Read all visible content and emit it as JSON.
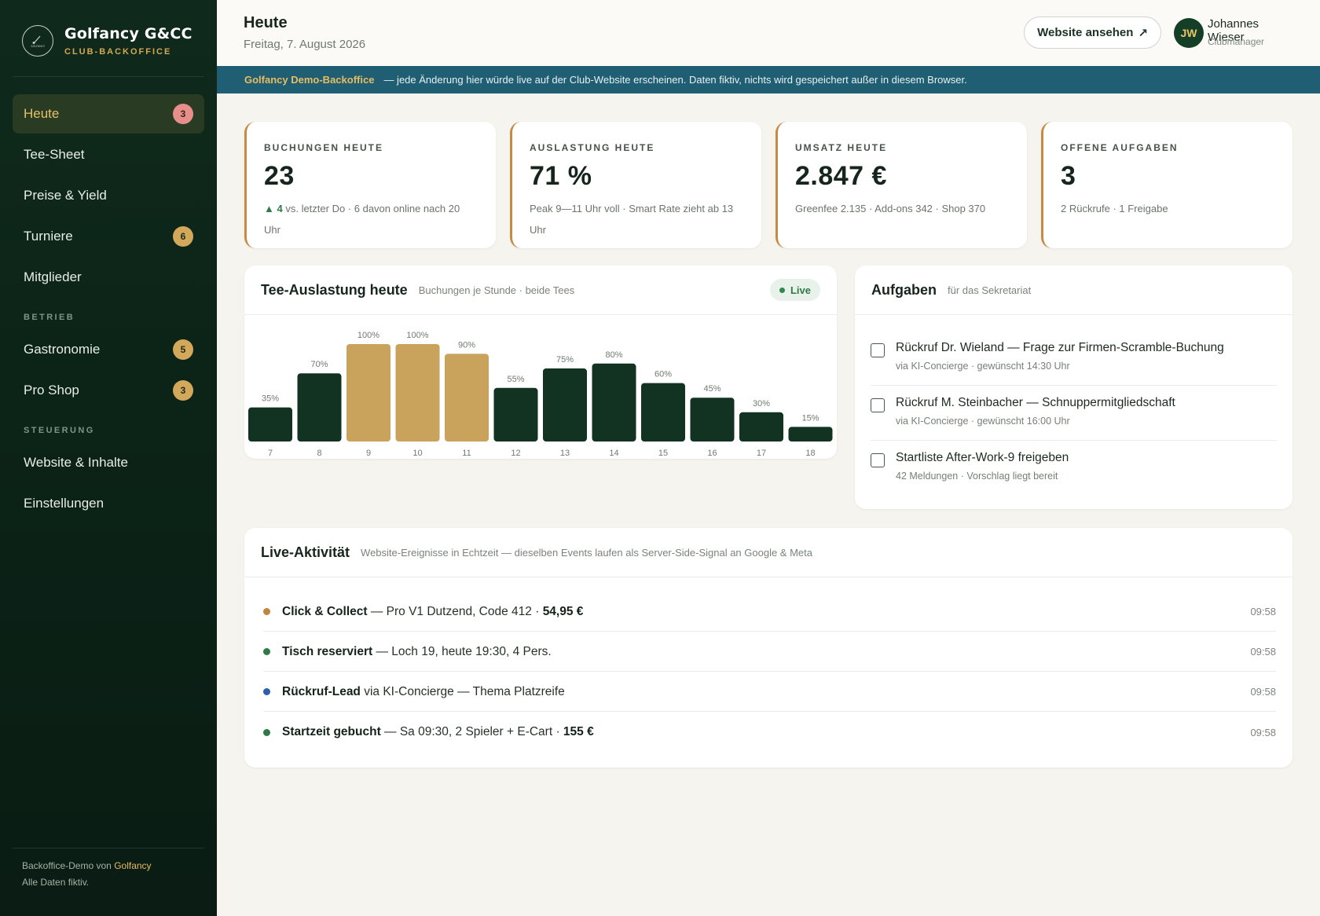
{
  "sidebar": {
    "brand_name": "Golfancy G&CC",
    "brand_sub": "CLUB-BACKOFFICE",
    "logo_text": "GOLFANCY",
    "items": [
      {
        "label": "Heute",
        "badge": "3"
      },
      {
        "label": "Tee-Sheet"
      },
      {
        "label": "Preise & Yield"
      },
      {
        "label": "Turniere",
        "badge": "6"
      },
      {
        "label": "Mitglieder"
      }
    ],
    "section_betrieb": "BETRIEB",
    "betrieb_items": [
      {
        "label": "Gastronomie",
        "badge": "5"
      },
      {
        "label": "Pro Shop",
        "badge": "3"
      }
    ],
    "section_steuerung": "STEUERUNG",
    "steuerung_items": [
      {
        "label": "Website & Inhalte"
      },
      {
        "label": "Einstellungen"
      }
    ],
    "footer_prefix": "Backoffice-Demo von",
    "footer_brand": "Golfancy",
    "footer_line2": "Alle Daten fiktiv."
  },
  "header": {
    "title": "Heute",
    "date": "Freitag, 7. August 2026",
    "website_button": "Website ansehen",
    "website_icon": "↗",
    "user_initials": "JW",
    "user_name": "Johannes Wieser",
    "user_role": "Clubmanager"
  },
  "banner": {
    "strong": "Golfancy Demo-Backoffice",
    "text": "— jede Änderung hier würde live auf der Club-Website erscheinen. Daten fiktiv, nichts wird gespeichert außer in diesem Browser."
  },
  "kpis": [
    {
      "label": "BUCHUNGEN HEUTE",
      "value": "23",
      "note_up": "▲ 4",
      "note": "vs. letzter Do · 6 davon online nach 20 Uhr"
    },
    {
      "label": "AUSLASTUNG HEUTE",
      "value": "71 %",
      "note": "Peak 9—11 Uhr voll · Smart Rate zieht ab 13 Uhr"
    },
    {
      "label": "UMSATZ HEUTE",
      "value": "2.847 €",
      "note": "Greenfee 2.135 · Add-ons 342 · Shop 370"
    },
    {
      "label": "OFFENE AUFGABEN",
      "value": "3",
      "note": "2 Rückrufe · 1 Freigabe"
    }
  ],
  "chart_panel": {
    "title": "Tee-Auslastung heute",
    "subtitle": "Buchungen je Stunde · beide Tees",
    "live_label": "Live"
  },
  "chart_data": {
    "type": "bar",
    "categories": [
      "7",
      "8",
      "9",
      "10",
      "11",
      "12",
      "13",
      "14",
      "15",
      "16",
      "17",
      "18"
    ],
    "values": [
      35,
      70,
      100,
      100,
      90,
      55,
      75,
      80,
      60,
      45,
      30,
      15
    ],
    "value_labels": [
      "35%",
      "70%",
      "100%",
      "100%",
      "90%",
      "55%",
      "75%",
      "80%",
      "60%",
      "45%",
      "30%",
      "15%"
    ],
    "highlighted": [
      false,
      false,
      true,
      true,
      true,
      false,
      false,
      false,
      false,
      false,
      false,
      false
    ],
    "ylim": [
      0,
      100
    ],
    "colors": {
      "normal": "#123322",
      "highlight": "#c9a25c"
    },
    "grid": false
  },
  "tasks_panel": {
    "title": "Aufgaben",
    "subtitle": "für das Sekretariat",
    "items": [
      {
        "title": "Rückruf Dr. Wieland — Frage zur Firmen-Scramble-Buchung",
        "meta": "via KI-Concierge · gewünscht 14:30 Uhr"
      },
      {
        "title": "Rückruf M. Steinbacher — Schnuppermitgliedschaft",
        "meta": "via KI-Concierge · gewünscht 16:00 Uhr"
      },
      {
        "title": "Startliste After-Work-9 freigeben",
        "meta": "42 Meldungen · Vorschlag liegt bereit"
      }
    ]
  },
  "activity_panel": {
    "title": "Live-Aktivität",
    "subtitle": "Website-Ereignisse in Echtzeit — dieselben Events laufen als Server-Side-Signal an Google & Meta",
    "items": [
      {
        "color": "#c0843f",
        "strong": "Click & Collect",
        "text": " — Pro V1 Dutzend, Code 412 · ",
        "strong2": "54,95 €",
        "time": "09:58"
      },
      {
        "color": "#2d7a47",
        "strong": "Tisch reserviert",
        "text": " — Loch 19, heute 19:30, 4 Pers.",
        "strong2": "",
        "time": "09:58"
      },
      {
        "color": "#2f5fa8",
        "strong": "Rückruf-Lead",
        "text": " via KI-Concierge — Thema Platzreife",
        "strong2": "",
        "time": "09:58"
      },
      {
        "color": "#2d7a47",
        "strong": "Startzeit gebucht",
        "text": " — Sa 09:30, 2 Spieler + E-Cart · ",
        "strong2": "155 €",
        "time": "09:58"
      }
    ]
  }
}
